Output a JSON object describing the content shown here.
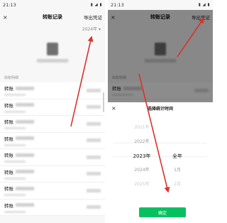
{
  "left": {
    "status_time": "21:13",
    "status_icons": "▮ ◢ ▮",
    "close_glyph": "×",
    "title": "转账记录",
    "export_label": "导出凭证",
    "year_picker": "2024年 ▾",
    "section_label": "转账明细",
    "rows": [
      {
        "name": "转账"
      },
      {
        "name": "转账"
      },
      {
        "name": "转账"
      },
      {
        "name": "转账"
      },
      {
        "name": "转账"
      },
      {
        "name": "转账"
      },
      {
        "name": "转账"
      },
      {
        "name": "转账"
      }
    ]
  },
  "right": {
    "status_time": "21:13",
    "status_icons": "▮ ◢ ▮",
    "close_glyph": "×",
    "title": "转账记录",
    "export_label": "导出凭证",
    "section_label": "转账明细",
    "rows": [
      {
        "name": "转账"
      },
      {
        "name": "转账"
      }
    ],
    "sheet": {
      "close_glyph": "×",
      "title": "选择统计时间",
      "years": [
        "2021年",
        "2022年",
        "2023年",
        "2024年",
        "2025年"
      ],
      "months": [
        "",
        "",
        "全年",
        "1月",
        "2月"
      ],
      "confirm_label": "确定"
    }
  },
  "annotation_color": "#d9322b"
}
